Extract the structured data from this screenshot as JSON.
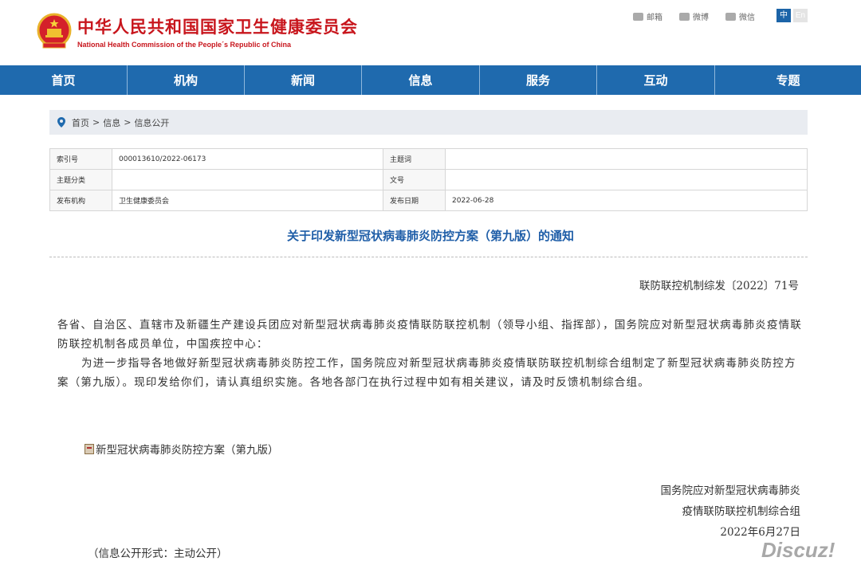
{
  "header": {
    "title_cn": "中华人民共和国国家卫生健康委员会",
    "title_en": "National Health Commission of the People´s Republic of China",
    "share": [
      {
        "label": "邮箱",
        "icon": "mail-icon"
      },
      {
        "label": "微博",
        "icon": "weibo-icon"
      },
      {
        "label": "微信",
        "icon": "wechat-icon"
      }
    ],
    "lang_zh": "中",
    "lang_en": "En"
  },
  "nav": [
    "首页",
    "机构",
    "新闻",
    "信息",
    "服务",
    "互动",
    "专题"
  ],
  "breadcrumb": [
    "首页",
    ">",
    "信息",
    ">",
    "信息公开"
  ],
  "meta": {
    "index_label": "索引号",
    "index_value": "000013610/2022-06173",
    "topic_word_label": "主题词",
    "topic_word_value": "",
    "category_label": "主题分类",
    "category_value": "",
    "doc_no_label": "文号",
    "doc_no_value": "",
    "publisher_label": "发布机构",
    "publisher_value": "卫生健康委员会",
    "date_label": "发布日期",
    "date_value": "2022-06-28"
  },
  "article": {
    "title": "关于印发新型冠状病毒肺炎防控方案（第九版）的通知",
    "doc_number": "联防联控机制综发〔2022〕71号",
    "para1": "各省、自治区、直辖市及新疆生产建设兵团应对新型冠状病毒肺炎疫情联防联控机制（领导小组、指挥部），国务院应对新型冠状病毒肺炎疫情联防联控机制各成员单位，中国疾控中心：",
    "para2": "为进一步指导各地做好新型冠状病毒肺炎防控工作，国务院应对新型冠状病毒肺炎疫情联防联控机制综合组制定了新型冠状病毒肺炎防控方案（第九版）。现印发给你们，请认真组织实施。各地各部门在执行过程中如有相关建议，请及时反馈机制综合组。",
    "attachment": "新型冠状病毒肺炎防控方案（第九版）",
    "signature_line1": "国务院应对新型冠状病毒肺炎",
    "signature_line2": "疫情联防联控机制综合组",
    "signature_date": "2022年6月27日",
    "disclosure": "（信息公开形式：主动公开）"
  },
  "watermark": "Discuz!",
  "colors": {
    "brand_red": "#c8161d",
    "nav_blue": "#1f6aae",
    "title_blue": "#1f5ea8"
  }
}
